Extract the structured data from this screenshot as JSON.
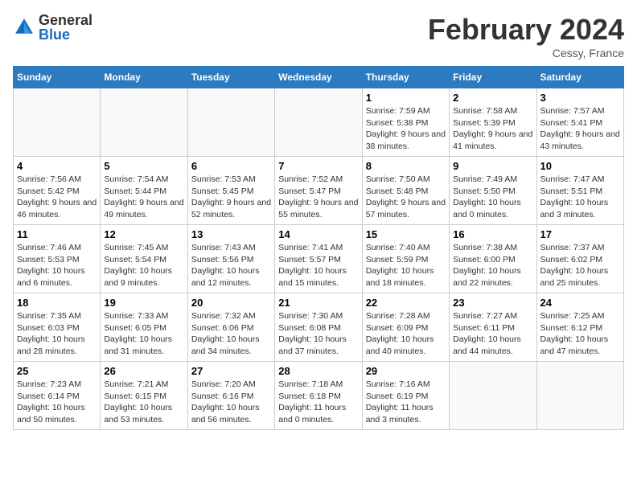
{
  "header": {
    "logo_general": "General",
    "logo_blue": "Blue",
    "title": "February 2024",
    "location": "Cessy, France"
  },
  "weekdays": [
    "Sunday",
    "Monday",
    "Tuesday",
    "Wednesday",
    "Thursday",
    "Friday",
    "Saturday"
  ],
  "weeks": [
    [
      {
        "day": "",
        "sunrise": "",
        "sunset": "",
        "daylight": ""
      },
      {
        "day": "",
        "sunrise": "",
        "sunset": "",
        "daylight": ""
      },
      {
        "day": "",
        "sunrise": "",
        "sunset": "",
        "daylight": ""
      },
      {
        "day": "",
        "sunrise": "",
        "sunset": "",
        "daylight": ""
      },
      {
        "day": "1",
        "sunrise": "Sunrise: 7:59 AM",
        "sunset": "Sunset: 5:38 PM",
        "daylight": "Daylight: 9 hours and 38 minutes."
      },
      {
        "day": "2",
        "sunrise": "Sunrise: 7:58 AM",
        "sunset": "Sunset: 5:39 PM",
        "daylight": "Daylight: 9 hours and 41 minutes."
      },
      {
        "day": "3",
        "sunrise": "Sunrise: 7:57 AM",
        "sunset": "Sunset: 5:41 PM",
        "daylight": "Daylight: 9 hours and 43 minutes."
      }
    ],
    [
      {
        "day": "4",
        "sunrise": "Sunrise: 7:56 AM",
        "sunset": "Sunset: 5:42 PM",
        "daylight": "Daylight: 9 hours and 46 minutes."
      },
      {
        "day": "5",
        "sunrise": "Sunrise: 7:54 AM",
        "sunset": "Sunset: 5:44 PM",
        "daylight": "Daylight: 9 hours and 49 minutes."
      },
      {
        "day": "6",
        "sunrise": "Sunrise: 7:53 AM",
        "sunset": "Sunset: 5:45 PM",
        "daylight": "Daylight: 9 hours and 52 minutes."
      },
      {
        "day": "7",
        "sunrise": "Sunrise: 7:52 AM",
        "sunset": "Sunset: 5:47 PM",
        "daylight": "Daylight: 9 hours and 55 minutes."
      },
      {
        "day": "8",
        "sunrise": "Sunrise: 7:50 AM",
        "sunset": "Sunset: 5:48 PM",
        "daylight": "Daylight: 9 hours and 57 minutes."
      },
      {
        "day": "9",
        "sunrise": "Sunrise: 7:49 AM",
        "sunset": "Sunset: 5:50 PM",
        "daylight": "Daylight: 10 hours and 0 minutes."
      },
      {
        "day": "10",
        "sunrise": "Sunrise: 7:47 AM",
        "sunset": "Sunset: 5:51 PM",
        "daylight": "Daylight: 10 hours and 3 minutes."
      }
    ],
    [
      {
        "day": "11",
        "sunrise": "Sunrise: 7:46 AM",
        "sunset": "Sunset: 5:53 PM",
        "daylight": "Daylight: 10 hours and 6 minutes."
      },
      {
        "day": "12",
        "sunrise": "Sunrise: 7:45 AM",
        "sunset": "Sunset: 5:54 PM",
        "daylight": "Daylight: 10 hours and 9 minutes."
      },
      {
        "day": "13",
        "sunrise": "Sunrise: 7:43 AM",
        "sunset": "Sunset: 5:56 PM",
        "daylight": "Daylight: 10 hours and 12 minutes."
      },
      {
        "day": "14",
        "sunrise": "Sunrise: 7:41 AM",
        "sunset": "Sunset: 5:57 PM",
        "daylight": "Daylight: 10 hours and 15 minutes."
      },
      {
        "day": "15",
        "sunrise": "Sunrise: 7:40 AM",
        "sunset": "Sunset: 5:59 PM",
        "daylight": "Daylight: 10 hours and 18 minutes."
      },
      {
        "day": "16",
        "sunrise": "Sunrise: 7:38 AM",
        "sunset": "Sunset: 6:00 PM",
        "daylight": "Daylight: 10 hours and 22 minutes."
      },
      {
        "day": "17",
        "sunrise": "Sunrise: 7:37 AM",
        "sunset": "Sunset: 6:02 PM",
        "daylight": "Daylight: 10 hours and 25 minutes."
      }
    ],
    [
      {
        "day": "18",
        "sunrise": "Sunrise: 7:35 AM",
        "sunset": "Sunset: 6:03 PM",
        "daylight": "Daylight: 10 hours and 28 minutes."
      },
      {
        "day": "19",
        "sunrise": "Sunrise: 7:33 AM",
        "sunset": "Sunset: 6:05 PM",
        "daylight": "Daylight: 10 hours and 31 minutes."
      },
      {
        "day": "20",
        "sunrise": "Sunrise: 7:32 AM",
        "sunset": "Sunset: 6:06 PM",
        "daylight": "Daylight: 10 hours and 34 minutes."
      },
      {
        "day": "21",
        "sunrise": "Sunrise: 7:30 AM",
        "sunset": "Sunset: 6:08 PM",
        "daylight": "Daylight: 10 hours and 37 minutes."
      },
      {
        "day": "22",
        "sunrise": "Sunrise: 7:28 AM",
        "sunset": "Sunset: 6:09 PM",
        "daylight": "Daylight: 10 hours and 40 minutes."
      },
      {
        "day": "23",
        "sunrise": "Sunrise: 7:27 AM",
        "sunset": "Sunset: 6:11 PM",
        "daylight": "Daylight: 10 hours and 44 minutes."
      },
      {
        "day": "24",
        "sunrise": "Sunrise: 7:25 AM",
        "sunset": "Sunset: 6:12 PM",
        "daylight": "Daylight: 10 hours and 47 minutes."
      }
    ],
    [
      {
        "day": "25",
        "sunrise": "Sunrise: 7:23 AM",
        "sunset": "Sunset: 6:14 PM",
        "daylight": "Daylight: 10 hours and 50 minutes."
      },
      {
        "day": "26",
        "sunrise": "Sunrise: 7:21 AM",
        "sunset": "Sunset: 6:15 PM",
        "daylight": "Daylight: 10 hours and 53 minutes."
      },
      {
        "day": "27",
        "sunrise": "Sunrise: 7:20 AM",
        "sunset": "Sunset: 6:16 PM",
        "daylight": "Daylight: 10 hours and 56 minutes."
      },
      {
        "day": "28",
        "sunrise": "Sunrise: 7:18 AM",
        "sunset": "Sunset: 6:18 PM",
        "daylight": "Daylight: 11 hours and 0 minutes."
      },
      {
        "day": "29",
        "sunrise": "Sunrise: 7:16 AM",
        "sunset": "Sunset: 6:19 PM",
        "daylight": "Daylight: 11 hours and 3 minutes."
      },
      {
        "day": "",
        "sunrise": "",
        "sunset": "",
        "daylight": ""
      },
      {
        "day": "",
        "sunrise": "",
        "sunset": "",
        "daylight": ""
      }
    ]
  ]
}
